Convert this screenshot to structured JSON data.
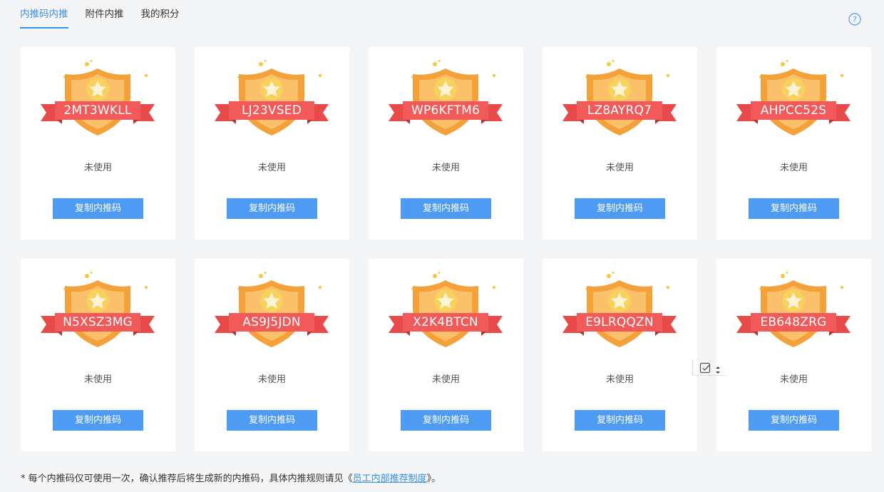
{
  "tabs": [
    {
      "label": "内推码内推",
      "active": true
    },
    {
      "label": "附件内推",
      "active": false
    },
    {
      "label": "我的积分",
      "active": false
    }
  ],
  "help_icon": "question-circle-icon",
  "cards": [
    {
      "code": "2MT3WKLL",
      "status": "未使用",
      "button": "复制内推码"
    },
    {
      "code": "LJ23VSED",
      "status": "未使用",
      "button": "复制内推码"
    },
    {
      "code": "WP6KFTM6",
      "status": "未使用",
      "button": "复制内推码"
    },
    {
      "code": "LZ8AYRQ7",
      "status": "未使用",
      "button": "复制内推码"
    },
    {
      "code": "AHPCC52S",
      "status": "未使用",
      "button": "复制内推码"
    },
    {
      "code": "N5XSZ3MG",
      "status": "未使用",
      "button": "复制内推码"
    },
    {
      "code": "AS9J5JDN",
      "status": "未使用",
      "button": "复制内推码"
    },
    {
      "code": "X2K4BTCN",
      "status": "未使用",
      "button": "复制内推码"
    },
    {
      "code": "E9LRQQZN",
      "status": "未使用",
      "button": "复制内推码"
    },
    {
      "code": "EB648ZRG",
      "status": "未使用",
      "button": "复制内推码"
    }
  ],
  "footer": {
    "prefix": "* 每个内推码仅可使用一次，确认推荐后将生成新的内推码，具体内推规则请见《",
    "link": "员工内部推荐制度",
    "suffix": "》。"
  },
  "colors": {
    "accent": "#3a8ee6",
    "button": "#4d9bf2",
    "ribbon": "#f25a5a",
    "shield": "#f5a13a",
    "background": "#f4f5f7"
  }
}
